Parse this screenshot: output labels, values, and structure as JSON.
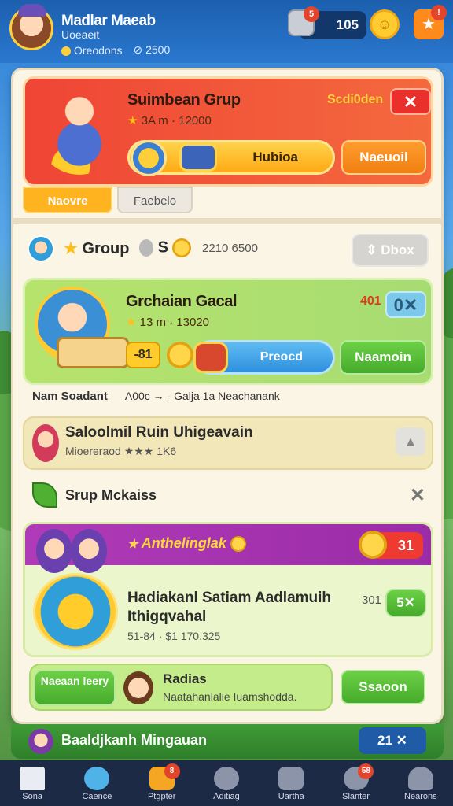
{
  "top_bar": {
    "player_name": "Madlar Maeab",
    "player_subtitle": "Uoeaeit",
    "stat_1": "Oreodons",
    "stat_2": "⊘ 2500",
    "resource_badge": "5",
    "resource_value": "105",
    "star_badge": "!"
  },
  "card_red": {
    "title": "Suimbean Grup",
    "subtitle": "3A m · 12000",
    "tag": "Scdi0den",
    "close": "✕",
    "bar_label": "Hubioa",
    "action": "Naeuoil"
  },
  "tabs": {
    "active": "Naovre",
    "inactive": "Faebelo"
  },
  "group_header": {
    "label": "Group",
    "s_label": "S",
    "number": "2210 6500",
    "button": "Dbox"
  },
  "card_green": {
    "title": "Grchaian Gacal",
    "subtitle": "13 m · 13020",
    "tag": "401",
    "close": "0✕",
    "chip": "-81",
    "bar_label": "Preocd",
    "action": "Naamoin"
  },
  "info_line": {
    "bold": "Nam Soadant",
    "text": "A00c → - Galja 1a Neachanank"
  },
  "card_tan": {
    "title": "Saloolmil Ruin Uhigeavain",
    "subtitle": "Mioereraod ★★★ 1K6"
  },
  "srup": {
    "label": "Srup Mckaiss",
    "close": "✕"
  },
  "card_purple": {
    "banner_title": "Anthelinglak",
    "badge": "31",
    "title": "Hadiakanl Satiam Aadlamuih Ithigqvahal",
    "subtitle": "51-84 · $1  170.325",
    "tag": "301",
    "button": "5✕"
  },
  "card_lime": {
    "left_button": "Naeaan leery",
    "title": "Radias",
    "subtitle": "Naatahanlalie Iuamshodda.",
    "action": "Ssaoon"
  },
  "bottom_banner": {
    "title": "Baaldjkanh Mingauan",
    "chip": "21 ✕"
  },
  "nav": [
    {
      "label": "Sona",
      "badge": ""
    },
    {
      "label": "Caence",
      "badge": ""
    },
    {
      "label": "Ptgpter",
      "badge": "8"
    },
    {
      "label": "Aditiag",
      "badge": ""
    },
    {
      "label": "Uartha",
      "badge": ""
    },
    {
      "label": "Slanter",
      "badge": "58"
    },
    {
      "label": "Nearons",
      "badge": ""
    }
  ]
}
